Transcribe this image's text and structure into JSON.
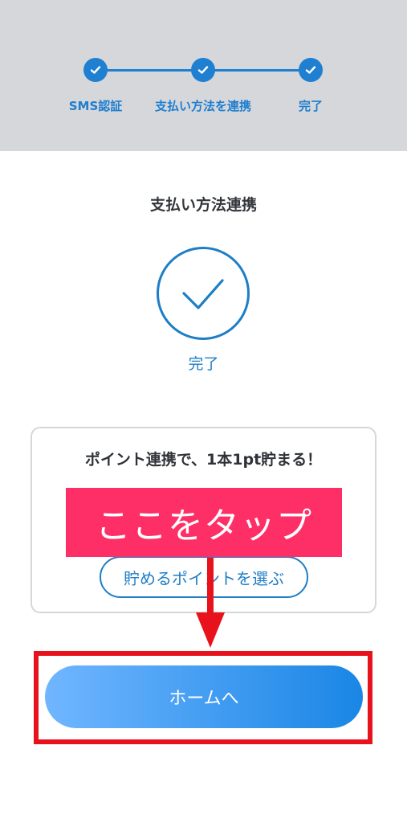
{
  "stepper": {
    "steps": [
      {
        "label": "SMS認証",
        "status": "done"
      },
      {
        "label": "支払い方法を連携",
        "status": "done"
      },
      {
        "label": "完了",
        "status": "done"
      }
    ],
    "accent_color": "#1f7fd0"
  },
  "main": {
    "title": "支払い方法連携",
    "status_icon": "check-circle-icon",
    "status_label": "完了"
  },
  "points_card": {
    "title": "ポイント連携で、1本1pt貯まる！",
    "button_label": "貯めるポイントを選ぶ"
  },
  "annotation": {
    "banner_text": "ここをタップ",
    "banner_color": "#fe2f67",
    "highlight_color": "#e8121d"
  },
  "home_button": {
    "label": "ホームへ"
  }
}
